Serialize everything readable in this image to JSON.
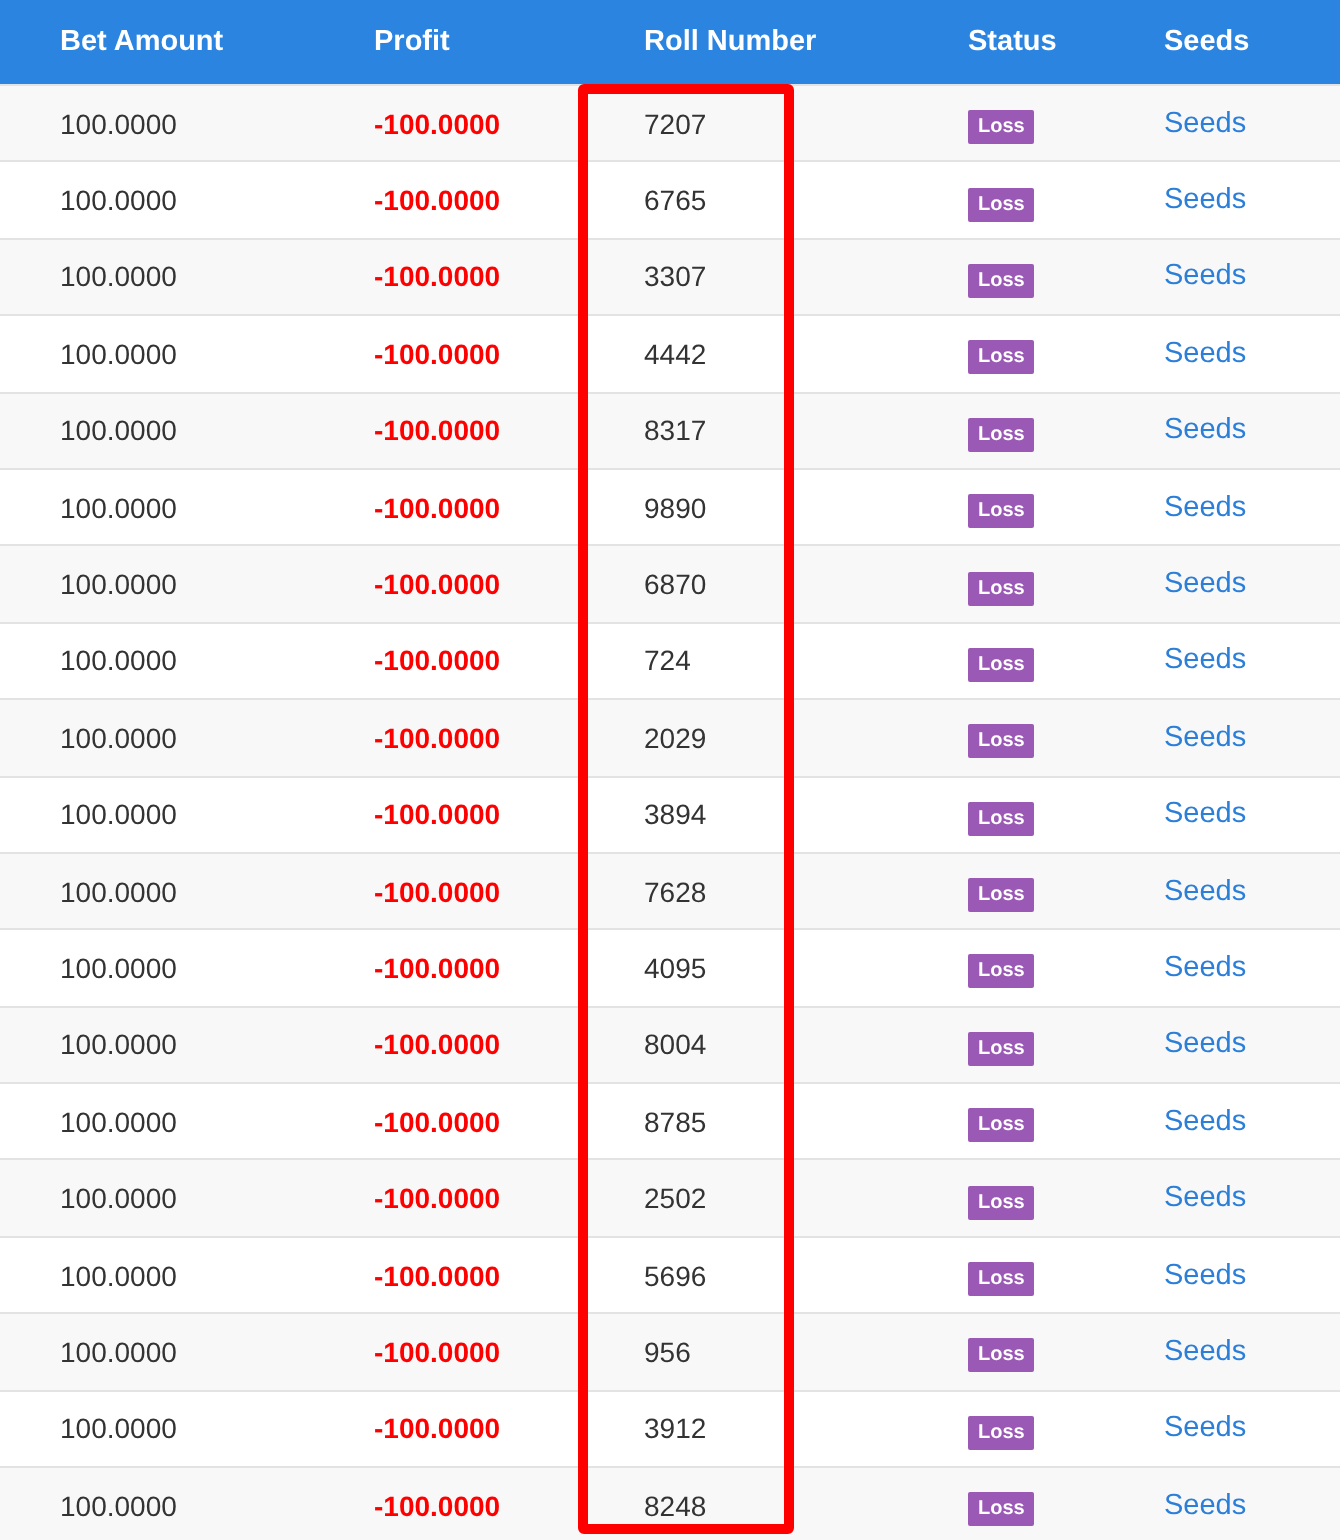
{
  "table": {
    "columns": [
      {
        "label": "Bet Amount",
        "highlighted": false
      },
      {
        "label": "Profit",
        "highlighted": false
      },
      {
        "label": "Roll Number",
        "highlighted": true
      },
      {
        "label": "Status",
        "highlighted": false
      },
      {
        "label": "Seeds",
        "highlighted": false
      }
    ],
    "rows": [
      {
        "bet": "100.0000",
        "profit": "-100.0000",
        "roll": "7207",
        "status": "Loss",
        "seeds": "Seeds"
      },
      {
        "bet": "100.0000",
        "profit": "-100.0000",
        "roll": "6765",
        "status": "Loss",
        "seeds": "Seeds"
      },
      {
        "bet": "100.0000",
        "profit": "-100.0000",
        "roll": "3307",
        "status": "Loss",
        "seeds": "Seeds"
      },
      {
        "bet": "100.0000",
        "profit": "-100.0000",
        "roll": "4442",
        "status": "Loss",
        "seeds": "Seeds"
      },
      {
        "bet": "100.0000",
        "profit": "-100.0000",
        "roll": "8317",
        "status": "Loss",
        "seeds": "Seeds"
      },
      {
        "bet": "100.0000",
        "profit": "-100.0000",
        "roll": "9890",
        "status": "Loss",
        "seeds": "Seeds"
      },
      {
        "bet": "100.0000",
        "profit": "-100.0000",
        "roll": "6870",
        "status": "Loss",
        "seeds": "Seeds"
      },
      {
        "bet": "100.0000",
        "profit": "-100.0000",
        "roll": "724",
        "status": "Loss",
        "seeds": "Seeds"
      },
      {
        "bet": "100.0000",
        "profit": "-100.0000",
        "roll": "2029",
        "status": "Loss",
        "seeds": "Seeds"
      },
      {
        "bet": "100.0000",
        "profit": "-100.0000",
        "roll": "3894",
        "status": "Loss",
        "seeds": "Seeds"
      },
      {
        "bet": "100.0000",
        "profit": "-100.0000",
        "roll": "7628",
        "status": "Loss",
        "seeds": "Seeds"
      },
      {
        "bet": "100.0000",
        "profit": "-100.0000",
        "roll": "4095",
        "status": "Loss",
        "seeds": "Seeds"
      },
      {
        "bet": "100.0000",
        "profit": "-100.0000",
        "roll": "8004",
        "status": "Loss",
        "seeds": "Seeds"
      },
      {
        "bet": "100.0000",
        "profit": "-100.0000",
        "roll": "8785",
        "status": "Loss",
        "seeds": "Seeds"
      },
      {
        "bet": "100.0000",
        "profit": "-100.0000",
        "roll": "2502",
        "status": "Loss",
        "seeds": "Seeds"
      },
      {
        "bet": "100.0000",
        "profit": "-100.0000",
        "roll": "5696",
        "status": "Loss",
        "seeds": "Seeds"
      },
      {
        "bet": "100.0000",
        "profit": "-100.0000",
        "roll": "956",
        "status": "Loss",
        "seeds": "Seeds"
      },
      {
        "bet": "100.0000",
        "profit": "-100.0000",
        "roll": "3912",
        "status": "Loss",
        "seeds": "Seeds"
      },
      {
        "bet": "100.0000",
        "profit": "-100.0000",
        "roll": "8248",
        "status": "Loss",
        "seeds": "Seeds"
      }
    ]
  }
}
